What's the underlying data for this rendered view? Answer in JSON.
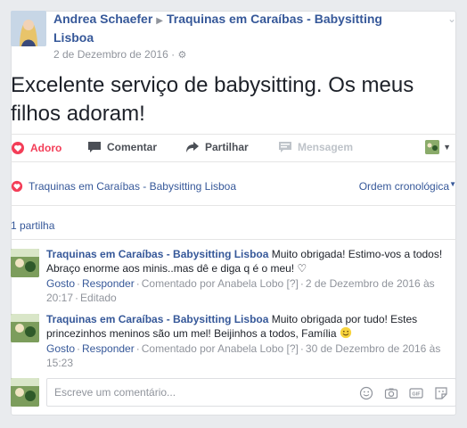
{
  "post": {
    "author": "Andrea Schaefer",
    "target_page": "Traquinas em Caraíbas - Babysitting Lisboa",
    "date": "2 de Dezembro de 2016",
    "text": "Excelente serviço de babysitting. Os meus filhos adoram!"
  },
  "actions": {
    "love": "Adoro",
    "comment": "Comentar",
    "share": "Partilhar",
    "message": "Mensagem"
  },
  "summary": {
    "reactor": "Traquinas em Caraíbas - Babysitting Lisboa",
    "order": "Ordem cronológica",
    "shares": "1 partilha"
  },
  "comments": [
    {
      "author": "Traquinas em Caraíbas - Babysitting Lisboa",
      "text": "Muito obrigada! Estimo-vos a todos! Abraço enorme aos minis..mas dê e diga q é o meu! ♡",
      "like": "Gosto",
      "reply": "Responder",
      "commented_by": "Comentado por Anabela Lobo",
      "report": "[?]",
      "date": "2 de Dezembro de 2016 às 20:17",
      "edited": "Editado"
    },
    {
      "author": "Traquinas em Caraíbas - Babysitting Lisboa",
      "text": "Muito obrigada por tudo! Estes princezinhos meninos são um mel! Beijinhos a todos, Família",
      "like": "Gosto",
      "reply": "Responder",
      "commented_by": "Comentado por Anabela Lobo",
      "report": "[?]",
      "date": "30 de Dezembro de 2016 às 15:23"
    }
  ],
  "reply_box": {
    "placeholder": "Escreve um comentário..."
  },
  "colors": {
    "link": "#365899",
    "love": "#f33e58",
    "muted": "#90949c"
  }
}
